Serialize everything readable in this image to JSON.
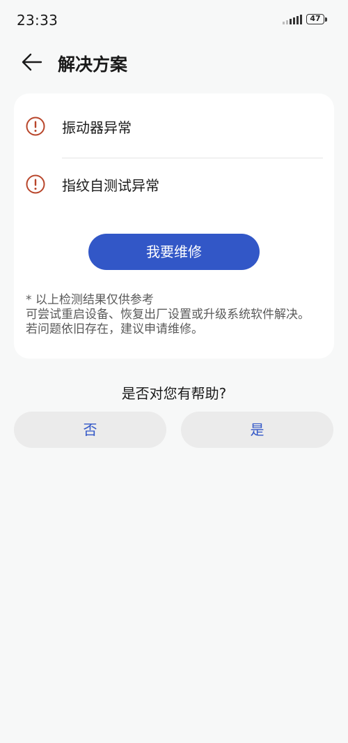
{
  "status_bar": {
    "time": "23:33",
    "battery": "47",
    "signal_icon": "signal-icon",
    "battery_icon": "battery-icon"
  },
  "header": {
    "back_icon": "arrow-left-icon",
    "title": "解决方案"
  },
  "issues": [
    {
      "icon": "warning-circle-icon",
      "label": "振动器异常"
    },
    {
      "icon": "warning-circle-icon",
      "label": "指纹自测试异常"
    }
  ],
  "repair_button_label": "我要维修",
  "note": {
    "line1": "* 以上检测结果仅供参考",
    "line2": "可尝试重启设备、恢复出厂设置或升级系统软件解决。若问题依旧存在，建议申请维修。"
  },
  "feedback": {
    "question": "是否对您有帮助?",
    "no_label": "否",
    "yes_label": "是"
  },
  "colors": {
    "accent": "#3257c7",
    "warning": "#b8452a",
    "background": "#f7f8f8",
    "card": "#ffffff",
    "secondary_button": "#ebebeb"
  }
}
